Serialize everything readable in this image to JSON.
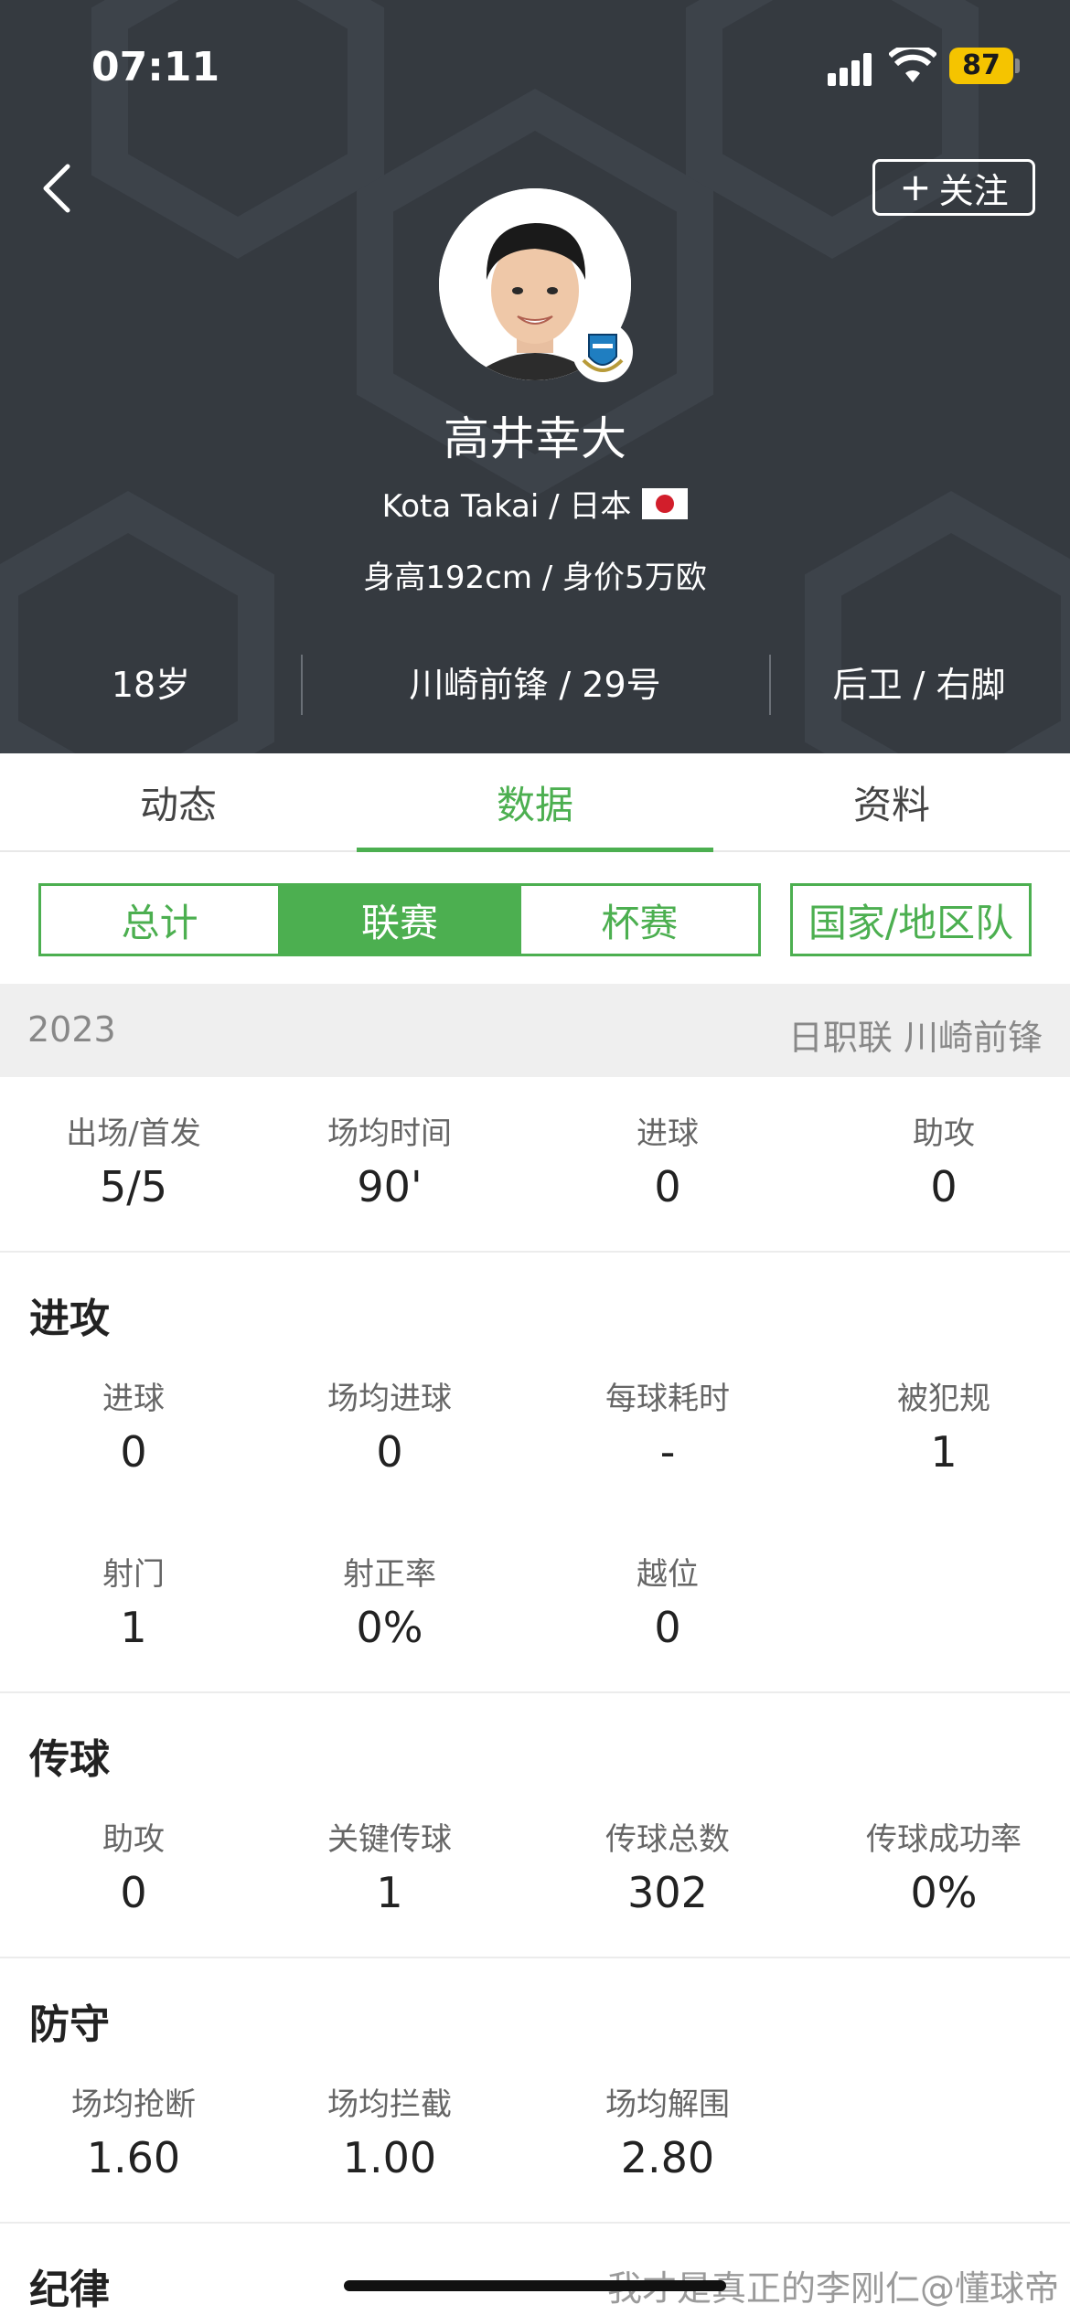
{
  "status": {
    "time": "07:11",
    "battery": "87"
  },
  "header": {
    "follow_label": "关注",
    "name": "高井幸大",
    "name_en_nation": "Kota Takai / 日本",
    "height_value": "身高192cm / 身价5万欧",
    "info": [
      "18岁",
      "川崎前锋 / 29号",
      "后卫 / 右脚"
    ]
  },
  "tabs": [
    {
      "label": "动态",
      "active": false
    },
    {
      "label": "数据",
      "active": true
    },
    {
      "label": "资料",
      "active": false
    }
  ],
  "segments": [
    {
      "label": "总计",
      "active": false
    },
    {
      "label": "联赛",
      "active": true
    },
    {
      "label": "杯赛",
      "active": false
    }
  ],
  "national_label": "国家/地区队",
  "season": {
    "year": "2023",
    "league": "日职联 川崎前锋"
  },
  "summary": [
    {
      "label": "出场/首发",
      "value": "5/5"
    },
    {
      "label": "场均时间",
      "value": "90'"
    },
    {
      "label": "进球",
      "value": "0"
    },
    {
      "label": "助攻",
      "value": "0"
    }
  ],
  "sections": {
    "attack": {
      "title": "进攻",
      "row1": [
        {
          "label": "进球",
          "value": "0"
        },
        {
          "label": "场均进球",
          "value": "0"
        },
        {
          "label": "每球耗时",
          "value": "-"
        },
        {
          "label": "被犯规",
          "value": "1"
        }
      ],
      "row2": [
        {
          "label": "射门",
          "value": "1"
        },
        {
          "label": "射正率",
          "value": "0%"
        },
        {
          "label": "越位",
          "value": "0"
        }
      ]
    },
    "passing": {
      "title": "传球",
      "row1": [
        {
          "label": "助攻",
          "value": "0"
        },
        {
          "label": "关键传球",
          "value": "1"
        },
        {
          "label": "传球总数",
          "value": "302"
        },
        {
          "label": "传球成功率",
          "value": "0%"
        }
      ]
    },
    "defense": {
      "title": "防守",
      "row1": [
        {
          "label": "场均抢断",
          "value": "1.60"
        },
        {
          "label": "场均拦截",
          "value": "1.00"
        },
        {
          "label": "场均解围",
          "value": "2.80"
        }
      ]
    },
    "discipline": {
      "title": "纪律"
    }
  },
  "watermark": "我才是真正的李刚仁@懂球帝",
  "colors": {
    "accent": "#4caf50",
    "header_bg": "#353a40",
    "battery": "#f5c400"
  }
}
